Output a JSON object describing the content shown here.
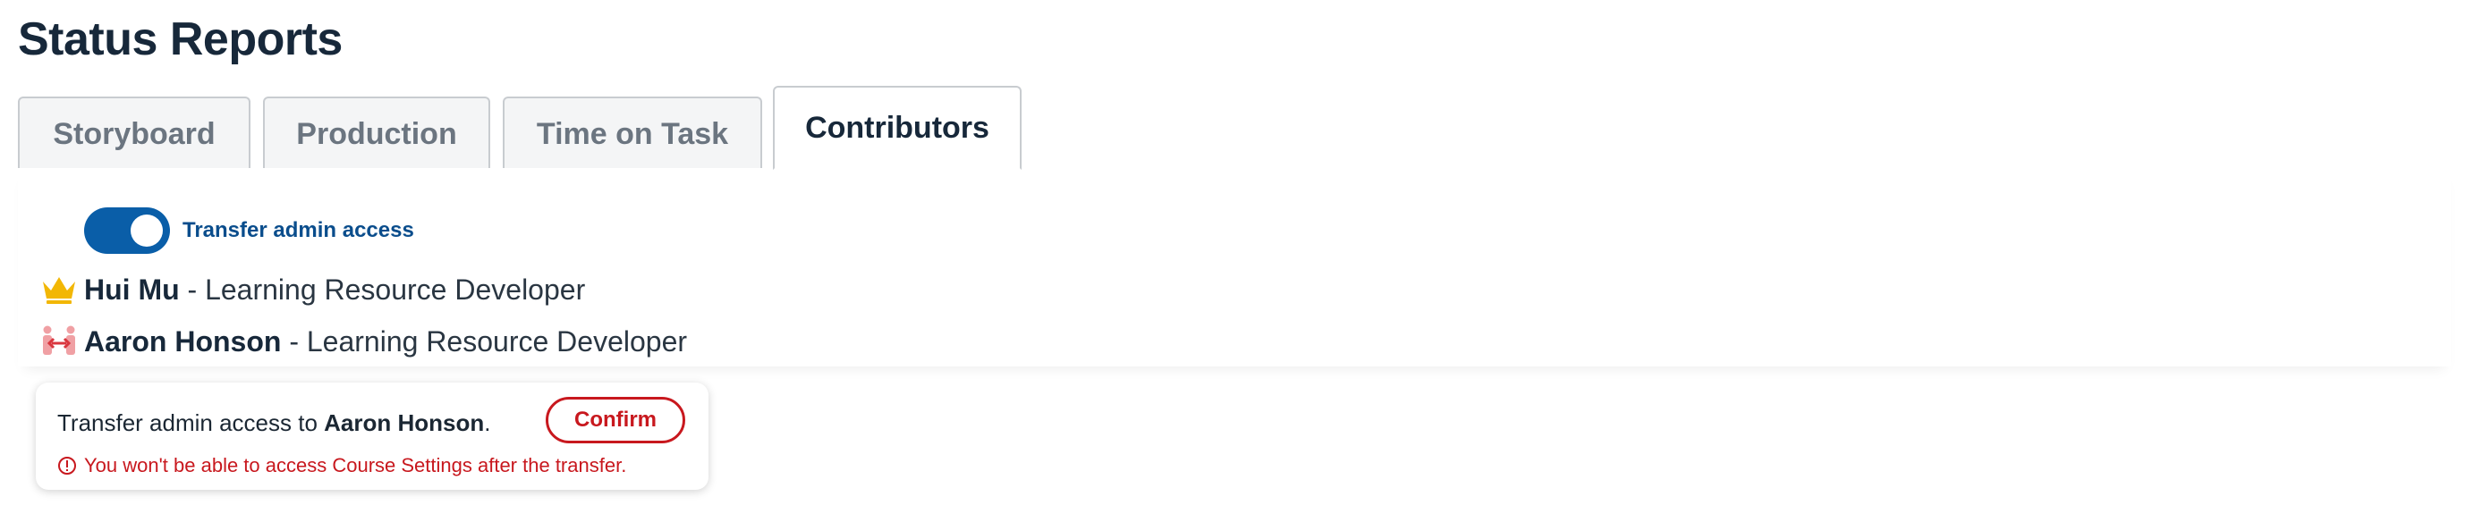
{
  "page": {
    "title": "Status Reports"
  },
  "tabs": [
    {
      "label": "Storyboard",
      "active": false
    },
    {
      "label": "Production",
      "active": false
    },
    {
      "label": "Time on Task",
      "active": false
    },
    {
      "label": "Contributors",
      "active": true
    }
  ],
  "toggle": {
    "label": "Transfer admin access",
    "on": true,
    "color": "#0a5ea8"
  },
  "contributors": [
    {
      "name": "Hui Mu",
      "separator": " - ",
      "role": "Learning Resource Developer",
      "icon": "crown-icon",
      "icon_color": "#f2b705"
    },
    {
      "name": "Aaron Honson",
      "separator": " - ",
      "role": "Learning Resource Developer",
      "icon": "transfer-people-icon",
      "icon_color": "#d9363e"
    }
  ],
  "popover": {
    "message_prefix": "Transfer admin access to ",
    "target_name": "Aaron Honson",
    "message_suffix": ".",
    "confirm_label": "Confirm",
    "warning": "You won't be able to access Course Settings after the transfer.",
    "warning_icon": "alert-circle-icon",
    "accent_color": "#c8181e"
  }
}
